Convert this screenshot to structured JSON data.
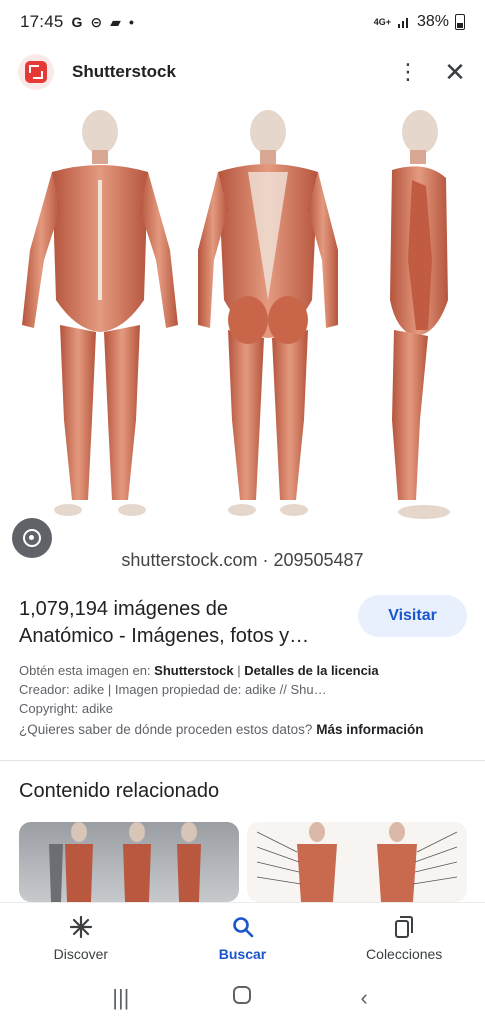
{
  "status_bar": {
    "time": "17:45",
    "left_icons": [
      "google-g-icon",
      "do-not-disturb-icon",
      "chat-icon",
      "dot-icon"
    ],
    "network": "4G+",
    "battery": "38%"
  },
  "header": {
    "site_name": "Shutterstock",
    "logo_color": "#e53935"
  },
  "image": {
    "watermark": "shutterstock.com · 209505487",
    "subject": "anatomy-muscle-figures"
  },
  "result": {
    "title_line1": "1,079,194 imágenes de",
    "title_line2": "Anatómico - Imágenes, fotos y…",
    "visit_label": "Visitar",
    "source_prefix": "Obtén esta imagen en: ",
    "source_name": "Shutterstock",
    "separator": " | ",
    "license_label": "Detalles de la licencia",
    "creator_line": "Creador: adike | Imagen propiedad de: adike // Shu…",
    "copyright_line": "Copyright: adike",
    "question": "¿Quieres saber de dónde proceden estos datos? ",
    "more_info": "Más información"
  },
  "related": {
    "title": "Contenido relacionado"
  },
  "bottom_nav": {
    "items": [
      {
        "label": "Discover",
        "icon": "asterisk-icon"
      },
      {
        "label": "Buscar",
        "icon": "search-icon"
      },
      {
        "label": "Colecciones",
        "icon": "collections-icon"
      }
    ],
    "active_color": "#1a56c9"
  }
}
